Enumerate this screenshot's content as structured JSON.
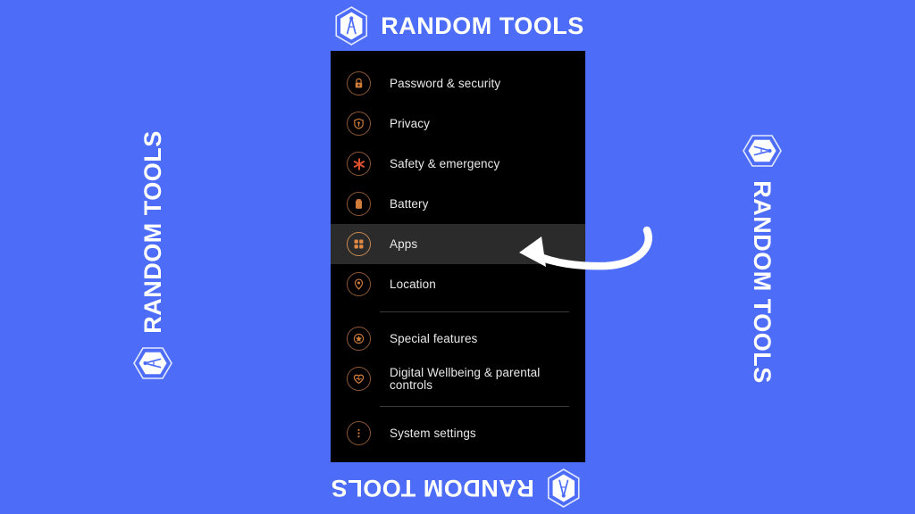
{
  "theme": {
    "page_background": "#4d6df8",
    "panel_background": "#000000",
    "selected_row_background": "#2b2b2b",
    "label_color": "#e9e9e9",
    "icon_ring_color": "#8d5736",
    "icon_glyph_color": "#d07d3c",
    "divider_color": "#3a3a3a",
    "arrow_color": "#ffffff",
    "brand_text_color": "#ffffff"
  },
  "brand": {
    "text": "RANDOM TOOLS",
    "logo_icon": "hexagon-compass-icon",
    "placements": [
      {
        "position": "top",
        "rotation_deg": 0
      },
      {
        "position": "right",
        "rotation_deg": 90
      },
      {
        "position": "bottom",
        "rotation_deg": 180
      },
      {
        "position": "left",
        "rotation_deg": 270
      }
    ]
  },
  "settings_panel": {
    "selected_item": "Apps",
    "groups": [
      {
        "items": [
          {
            "label": "Password & security",
            "icon": "lock-icon",
            "selected": false
          },
          {
            "label": "Privacy",
            "icon": "shield-privacy-icon",
            "selected": false
          },
          {
            "label": "Safety & emergency",
            "icon": "emergency-asterisk-icon",
            "selected": false
          },
          {
            "label": "Battery",
            "icon": "battery-icon",
            "selected": false
          },
          {
            "label": "Apps",
            "icon": "apps-grid-icon",
            "selected": true
          },
          {
            "label": "Location",
            "icon": "location-pin-icon",
            "selected": false
          }
        ]
      },
      {
        "items": [
          {
            "label": "Special features",
            "icon": "star-icon",
            "selected": false
          },
          {
            "label": "Digital Wellbeing & parental controls",
            "icon": "heart-icon",
            "selected": false
          }
        ]
      },
      {
        "items": [
          {
            "label": "System settings",
            "icon": "more-vertical-dots-icon",
            "selected": false
          }
        ]
      }
    ]
  },
  "annotation": {
    "arrow": {
      "icon": "curved-left-arrow-icon",
      "points_to": "Apps",
      "direction": "left"
    }
  }
}
